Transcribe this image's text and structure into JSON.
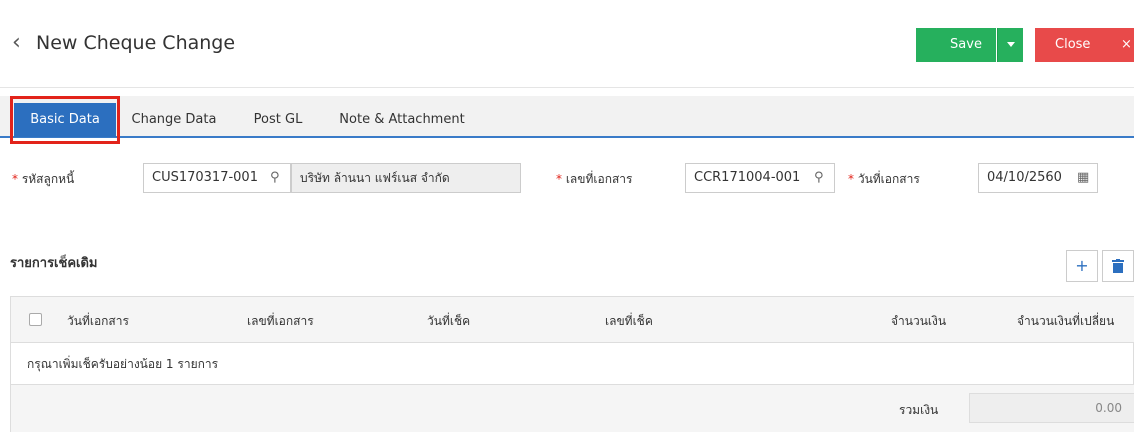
{
  "header": {
    "title": "New Cheque Change",
    "save_label": "Save",
    "close_label": "Close",
    "close_x": "×"
  },
  "tabs": [
    {
      "label": "Basic Data"
    },
    {
      "label": "Change Data"
    },
    {
      "label": "Post GL"
    },
    {
      "label": "Note & Attachment"
    }
  ],
  "form": {
    "debtor_code_label": "รหัสลูกหนี้",
    "debtor_code_value": "CUS170317-001",
    "debtor_name_value": "บริษัท ล้านนา แฟร์เนส จำกัด",
    "doc_no_label": "เลขที่เอกสาร",
    "doc_no_value": "CCR171004-001",
    "doc_date_label": "วันที่เอกสาร",
    "doc_date_value": "04/10/2560",
    "required_mark": "*"
  },
  "section": {
    "title": "รายการเช็คเดิม",
    "add_icon": "+"
  },
  "table": {
    "columns": [
      "วันที่เอกสาร",
      "เลขที่เอกสาร",
      "วันที่เช็ค",
      "เลขที่เช็ค",
      "จำนวนเงิน",
      "จำนวนเงินที่เปลี่ยน"
    ],
    "empty_message": "กรุณาเพิ่มเช็ครับอย่างน้อย 1 รายการ",
    "total_label": "รวมเงิน",
    "total_value": "0.00"
  },
  "colors": {
    "save": "#26b05d",
    "close": "#e84a4a",
    "tab_active": "#2c6fbf",
    "highlight": "#e2231a"
  }
}
